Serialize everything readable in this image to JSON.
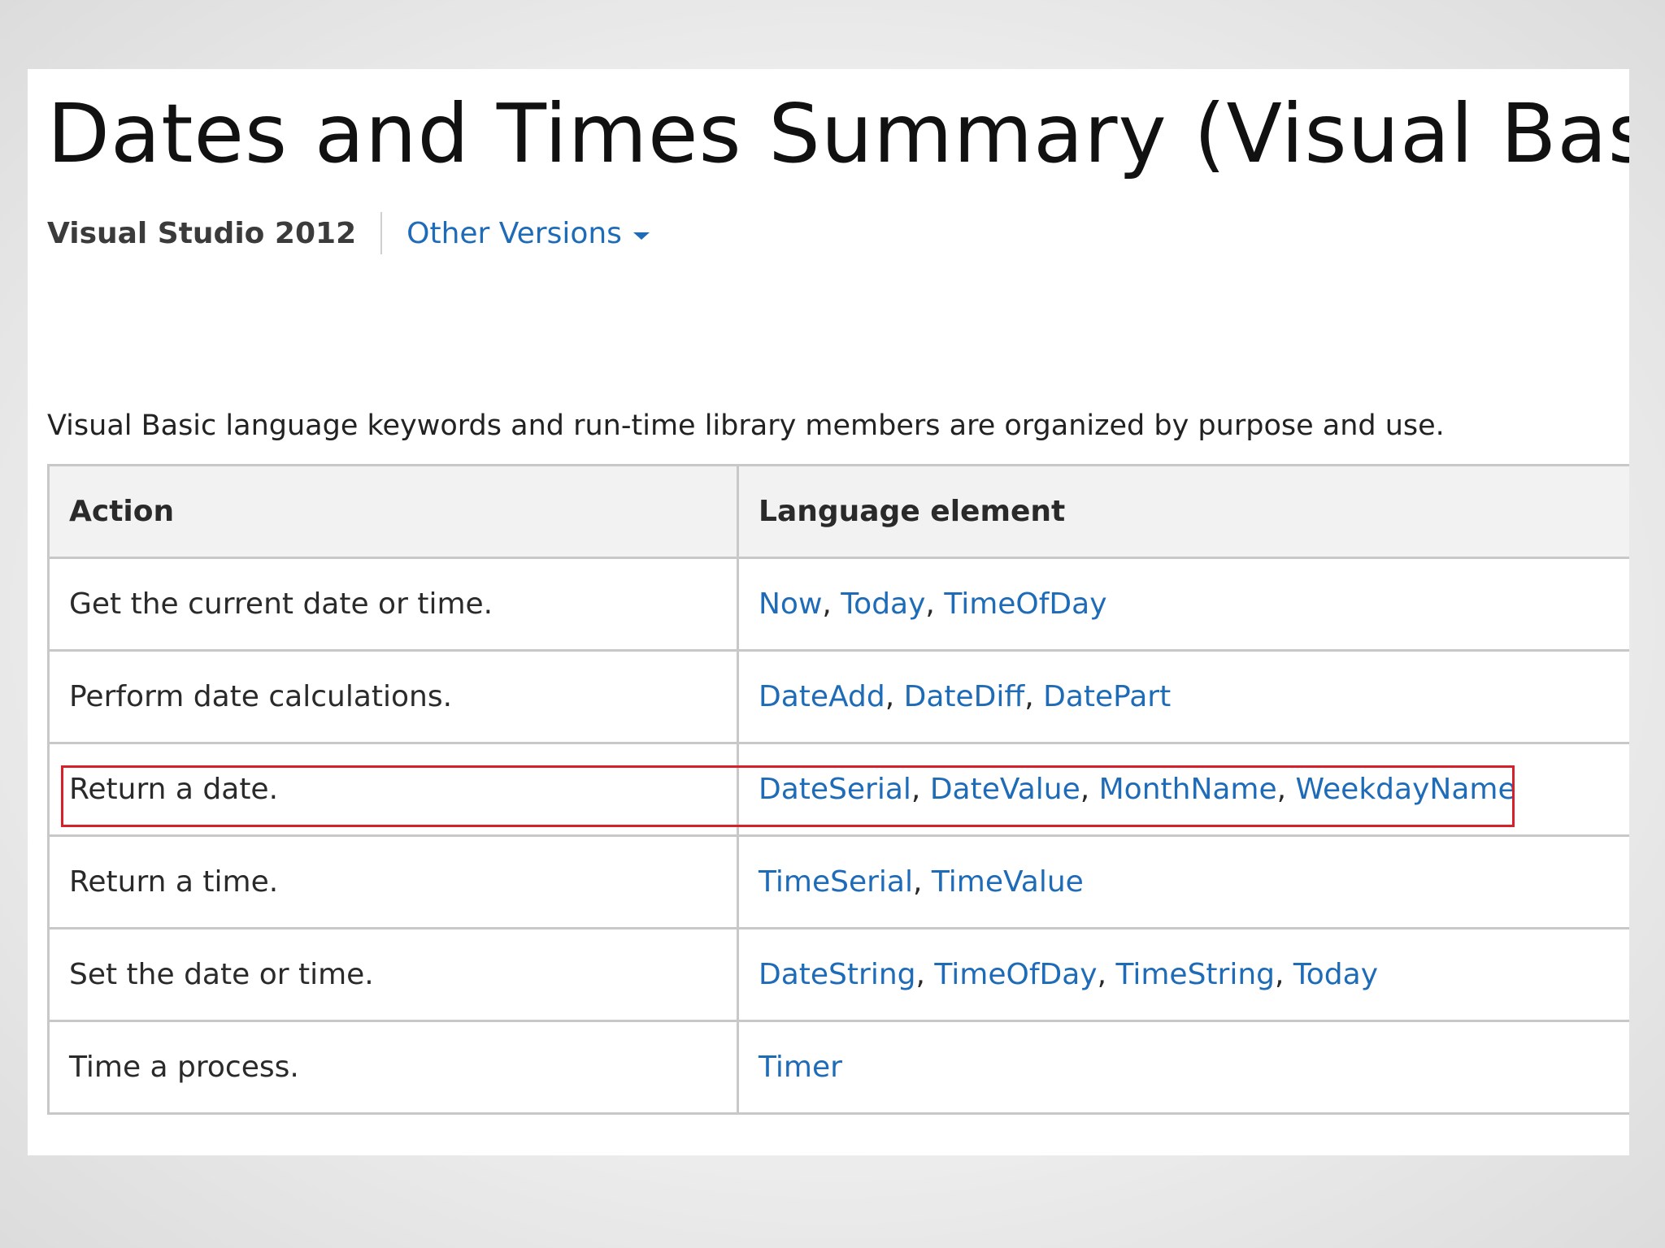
{
  "page": {
    "title": "Dates and Times Summary (Visual Basic)",
    "product": "Visual Studio 2012",
    "other_versions_label": "Other Versions",
    "intro": "Visual Basic language keywords and run-time library members are organized by purpose and use."
  },
  "table": {
    "headers": {
      "action": "Action",
      "language_element": "Language element"
    },
    "rows": [
      {
        "action": "Get the current date or time.",
        "elements": [
          "Now",
          "Today",
          "TimeOfDay"
        ]
      },
      {
        "action": "Perform date calculations.",
        "elements": [
          "DateAdd",
          "DateDiff",
          "DatePart"
        ]
      },
      {
        "action": "Return a date.",
        "elements": [
          "DateSerial",
          "DateValue",
          "MonthName",
          "WeekdayName"
        ],
        "highlighted": true
      },
      {
        "action": "Return a time.",
        "elements": [
          "TimeSerial",
          "TimeValue"
        ]
      },
      {
        "action": "Set the date or time.",
        "elements": [
          "DateString",
          "TimeOfDay",
          "TimeString",
          "Today"
        ]
      },
      {
        "action": "Time a process.",
        "elements": [
          "Timer"
        ]
      }
    ]
  },
  "colors": {
    "link": "#1e6bb8",
    "highlight_border": "#d6202a",
    "header_background": "#f2f2f2",
    "grid_border": "#c8c8c8"
  },
  "icons": {
    "versions_dropdown": "caret-down-icon"
  }
}
